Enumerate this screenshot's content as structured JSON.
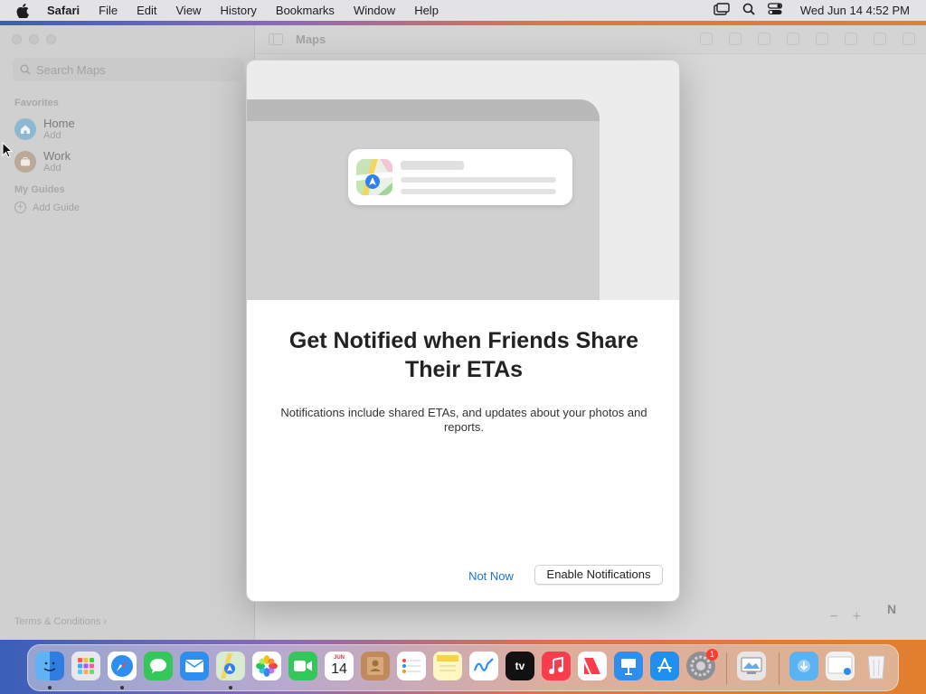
{
  "menubar": {
    "app_name": "Safari",
    "items": [
      "File",
      "Edit",
      "View",
      "History",
      "Bookmarks",
      "Window",
      "Help"
    ],
    "clock": "Wed Jun 14  4:52 PM"
  },
  "sidebar": {
    "search_placeholder": "Search Maps",
    "favorites_label": "Favorites",
    "favorites": [
      {
        "title": "Home",
        "subtitle": "Add"
      },
      {
        "title": "Work",
        "subtitle": "Add"
      }
    ],
    "my_guides_label": "My Guides",
    "add_guide_label": "Add Guide",
    "terms_label": "Terms & Conditions"
  },
  "toolbar": {
    "title": "Maps"
  },
  "map_controls": {
    "zoom_out": "−",
    "zoom_in": "+",
    "compass": "N"
  },
  "modal": {
    "title": "Get Notified when Friends Share Their ETAs",
    "description": "Notifications include shared ETAs, and updates about your photos and reports.",
    "not_now_label": "Not Now",
    "enable_label": "Enable Notifications"
  },
  "dock": {
    "calendar_month": "JUN",
    "calendar_day": "14",
    "settings_badge": "1",
    "tv_label": "tv"
  },
  "colors": {
    "accent": "#1a73d9",
    "badge": "#ff3b30"
  }
}
